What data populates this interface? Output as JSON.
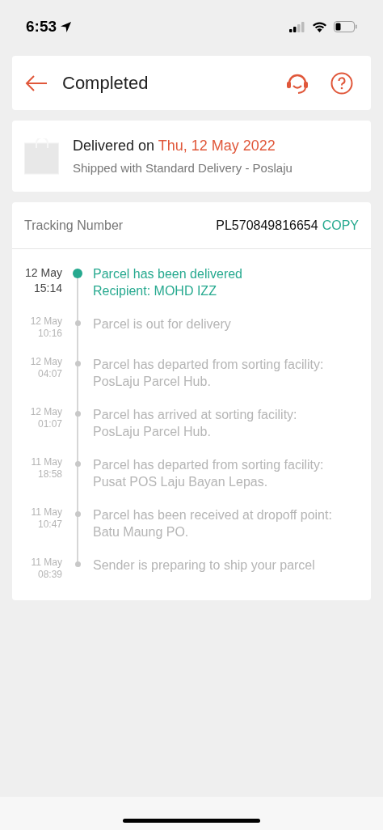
{
  "status_bar": {
    "time": "6:53"
  },
  "header": {
    "title": "Completed"
  },
  "delivery": {
    "prefix": "Delivered on ",
    "date": "Thu, 12 May 2022",
    "shipping": "Shipped with Standard Delivery - Poslaju"
  },
  "tracking": {
    "label": "Tracking Number",
    "number": "PL570849816654",
    "copy": "COPY"
  },
  "events": [
    {
      "date": "12 May",
      "time": "15:14",
      "lines": [
        "Parcel has been delivered",
        "Recipient: MOHD IZZ"
      ],
      "current": true
    },
    {
      "date": "12 May",
      "time": "10:16",
      "lines": [
        "Parcel is out for delivery"
      ],
      "current": false
    },
    {
      "date": "12 May",
      "time": "04:07",
      "lines": [
        "Parcel has departed from sorting facility:",
        "PosLaju Parcel Hub."
      ],
      "current": false
    },
    {
      "date": "12 May",
      "time": "01:07",
      "lines": [
        "Parcel has arrived at sorting facility:",
        "PosLaju Parcel Hub."
      ],
      "current": false
    },
    {
      "date": "11 May",
      "time": "18:58",
      "lines": [
        "Parcel has departed from sorting facility:",
        "Pusat POS Laju Bayan Lepas."
      ],
      "current": false
    },
    {
      "date": "11 May",
      "time": "10:47",
      "lines": [
        "Parcel has been received at dropoff point:",
        "Batu Maung PO."
      ],
      "current": false
    },
    {
      "date": "11 May",
      "time": "08:39",
      "lines": [
        "Sender is preparing to ship your parcel"
      ],
      "current": false
    }
  ]
}
